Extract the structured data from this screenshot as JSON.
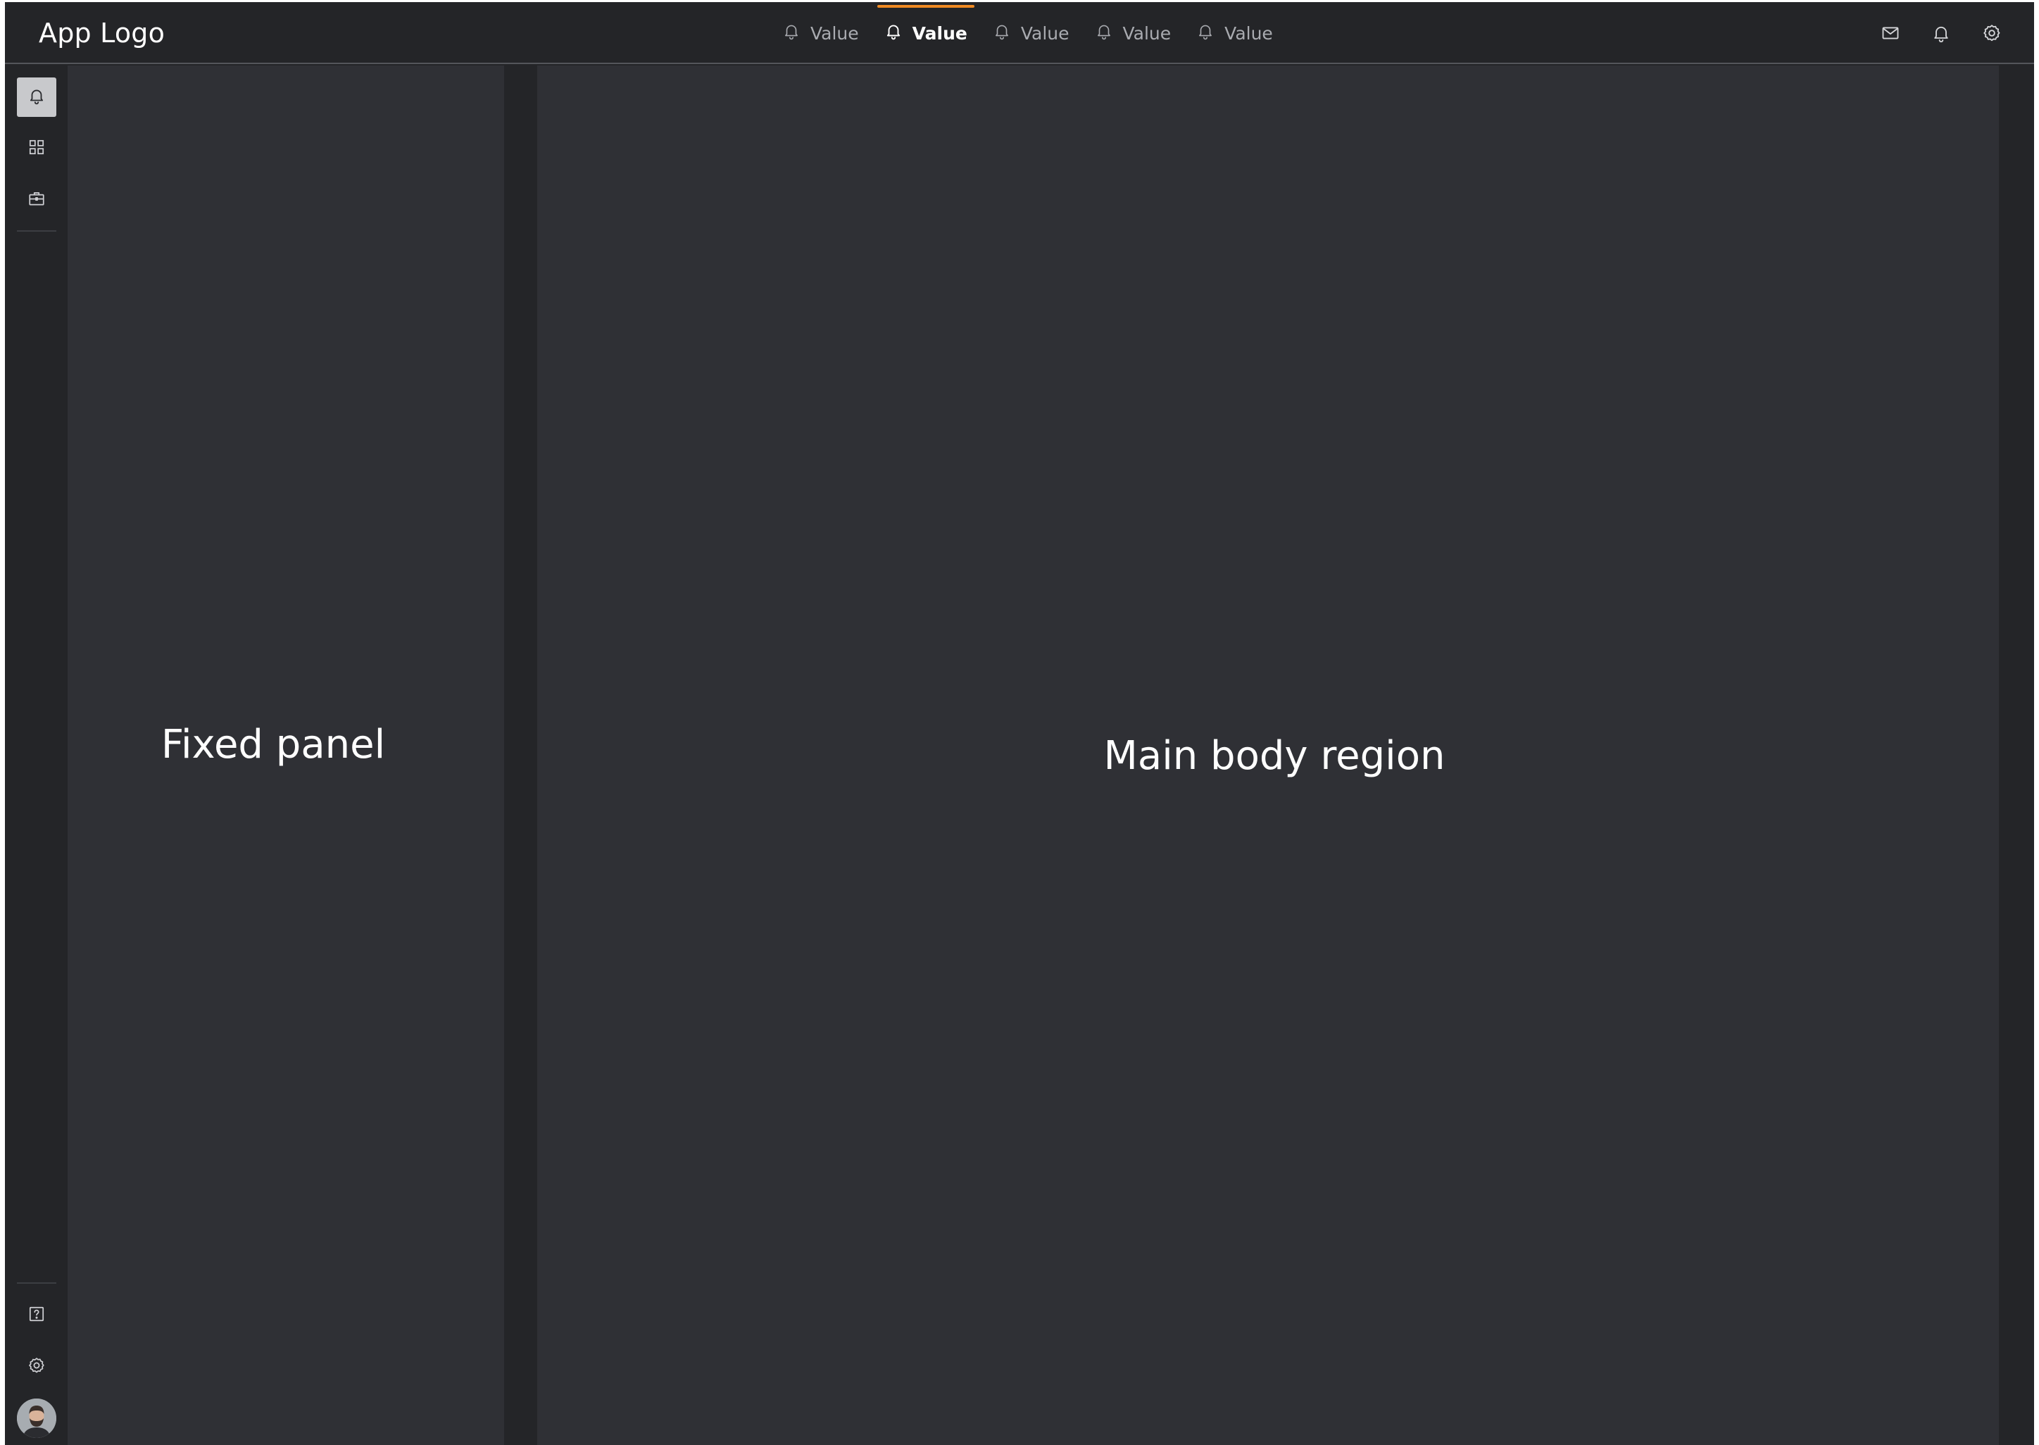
{
  "header": {
    "app_logo": "App Logo",
    "tabs": [
      {
        "label": "Value",
        "icon": "bell-icon",
        "active": false
      },
      {
        "label": "Value",
        "icon": "bell-icon",
        "active": true
      },
      {
        "label": "Value",
        "icon": "bell-icon",
        "active": false
      },
      {
        "label": "Value",
        "icon": "bell-icon",
        "active": false
      },
      {
        "label": "Value",
        "icon": "bell-icon",
        "active": false
      }
    ],
    "actions": [
      "mail-icon",
      "bell-icon",
      "gear-icon"
    ]
  },
  "sidebar": {
    "top_items": [
      {
        "icon": "bell-icon",
        "active": true
      },
      {
        "icon": "grid-icon",
        "active": false
      },
      {
        "icon": "briefcase-icon",
        "active": false
      }
    ],
    "bottom_items": [
      {
        "icon": "help-icon"
      },
      {
        "icon": "gear-icon"
      },
      {
        "icon": "avatar"
      }
    ]
  },
  "panels": {
    "fixed_panel_label": "Fixed panel",
    "main_body_label": "Main body region"
  },
  "colors": {
    "accent": "#f08a24",
    "chrome_bg": "#242528",
    "panel_bg": "#2f3035",
    "text": "#ffffff"
  }
}
